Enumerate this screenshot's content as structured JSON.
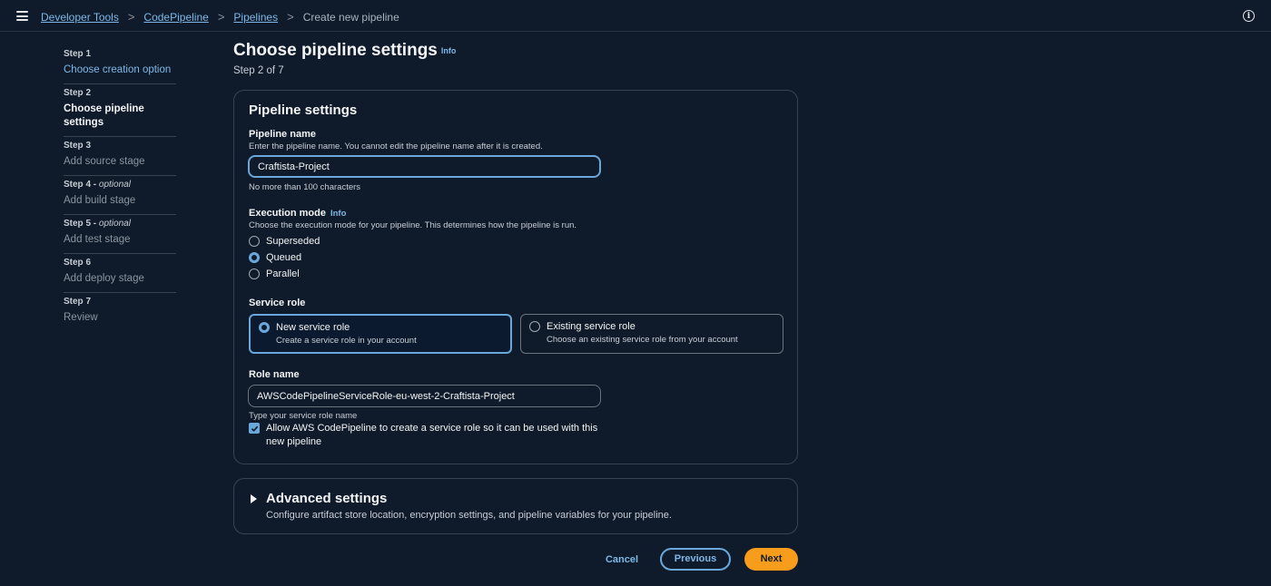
{
  "breadcrumb": {
    "items": [
      "Developer Tools",
      "CodePipeline",
      "Pipelines"
    ],
    "current": "Create new pipeline",
    "separator": ">"
  },
  "steps": [
    {
      "num": "Step 1",
      "label": "Choose creation option",
      "state": "completed"
    },
    {
      "num": "Step 2",
      "label": "Choose pipeline settings",
      "state": "current"
    },
    {
      "num": "Step 3",
      "label": "Add source stage",
      "state": "upcoming"
    },
    {
      "num": "Step 4",
      "optional": "optional",
      "label": "Add build stage",
      "state": "upcoming"
    },
    {
      "num": "Step 5",
      "optional": "optional",
      "label": "Add test stage",
      "state": "upcoming"
    },
    {
      "num": "Step 6",
      "label": "Add deploy stage",
      "state": "upcoming"
    },
    {
      "num": "Step 7",
      "label": "Review",
      "state": "upcoming"
    }
  ],
  "header": {
    "title": "Choose pipeline settings",
    "info": "Info",
    "subtitle": "Step 2 of 7"
  },
  "pipeline_settings": {
    "title": "Pipeline settings",
    "pipeline_name": {
      "label": "Pipeline name",
      "description": "Enter the pipeline name. You cannot edit the pipeline name after it is created.",
      "value": "Craftista-Project",
      "constraint": "No more than 100 characters"
    },
    "execution_mode": {
      "label": "Execution mode",
      "info": "Info",
      "description": "Choose the execution mode for your pipeline. This determines how the pipeline is run.",
      "options": [
        "Superseded",
        "Queued",
        "Parallel"
      ],
      "selected": "Queued"
    },
    "service_role": {
      "label": "Service role",
      "options": [
        {
          "title": "New service role",
          "description": "Create a service role in your account",
          "selected": true
        },
        {
          "title": "Existing service role",
          "description": "Choose an existing service role from your account",
          "selected": false
        }
      ]
    },
    "role_name": {
      "label": "Role name",
      "value": "AWSCodePipelineServiceRole-eu-west-2-Craftista-Project",
      "hint": "Type your service role name"
    },
    "allow_checkbox": {
      "label": "Allow AWS CodePipeline to create a service role so it can be used with this new pipeline",
      "checked": true
    }
  },
  "advanced_settings": {
    "title": "Advanced settings",
    "description": "Configure artifact store location, encryption settings, and pipeline variables for your pipeline.",
    "expanded": false
  },
  "footer": {
    "cancel": "Cancel",
    "previous": "Previous",
    "next": "Next"
  },
  "colors": {
    "background": "#0f1b2a",
    "link": "#7fb8e8",
    "accent": "#6aa8dc",
    "primary_button": "#f89c1c"
  }
}
